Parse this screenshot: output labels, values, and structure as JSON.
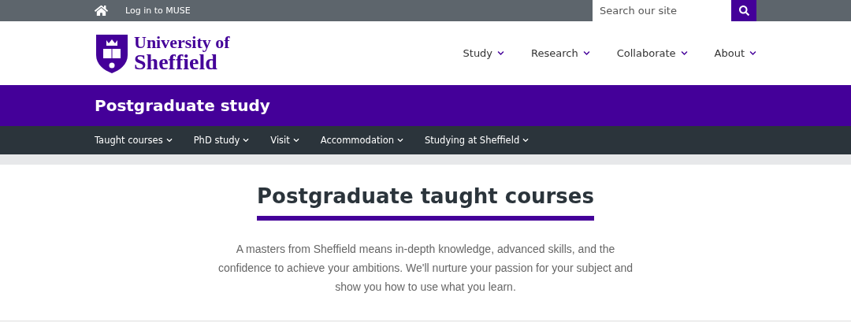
{
  "top_bar": {
    "login_link": "Log in to MUSE",
    "search": {
      "placeholder": "Search our site"
    }
  },
  "logo": {
    "line_1": "University of",
    "line_2": "Sheffield"
  },
  "main_nav": [
    {
      "label": "Study"
    },
    {
      "label": "Research"
    },
    {
      "label": "Collaborate"
    },
    {
      "label": "About"
    }
  ],
  "section_title": "Postgraduate study",
  "sub_nav": [
    {
      "label": "Taught courses"
    },
    {
      "label": "PhD study"
    },
    {
      "label": "Visit"
    },
    {
      "label": "Accommodation"
    },
    {
      "label": "Studying at Sheffield"
    }
  ],
  "hero": {
    "heading": "Postgraduate taught courses",
    "intro": "A masters from Sheffield means in-depth knowledge, advanced skills, and the confidence to achieve your ambitions. We'll nurture your passion for your subject and show you how to use what you learn."
  }
}
